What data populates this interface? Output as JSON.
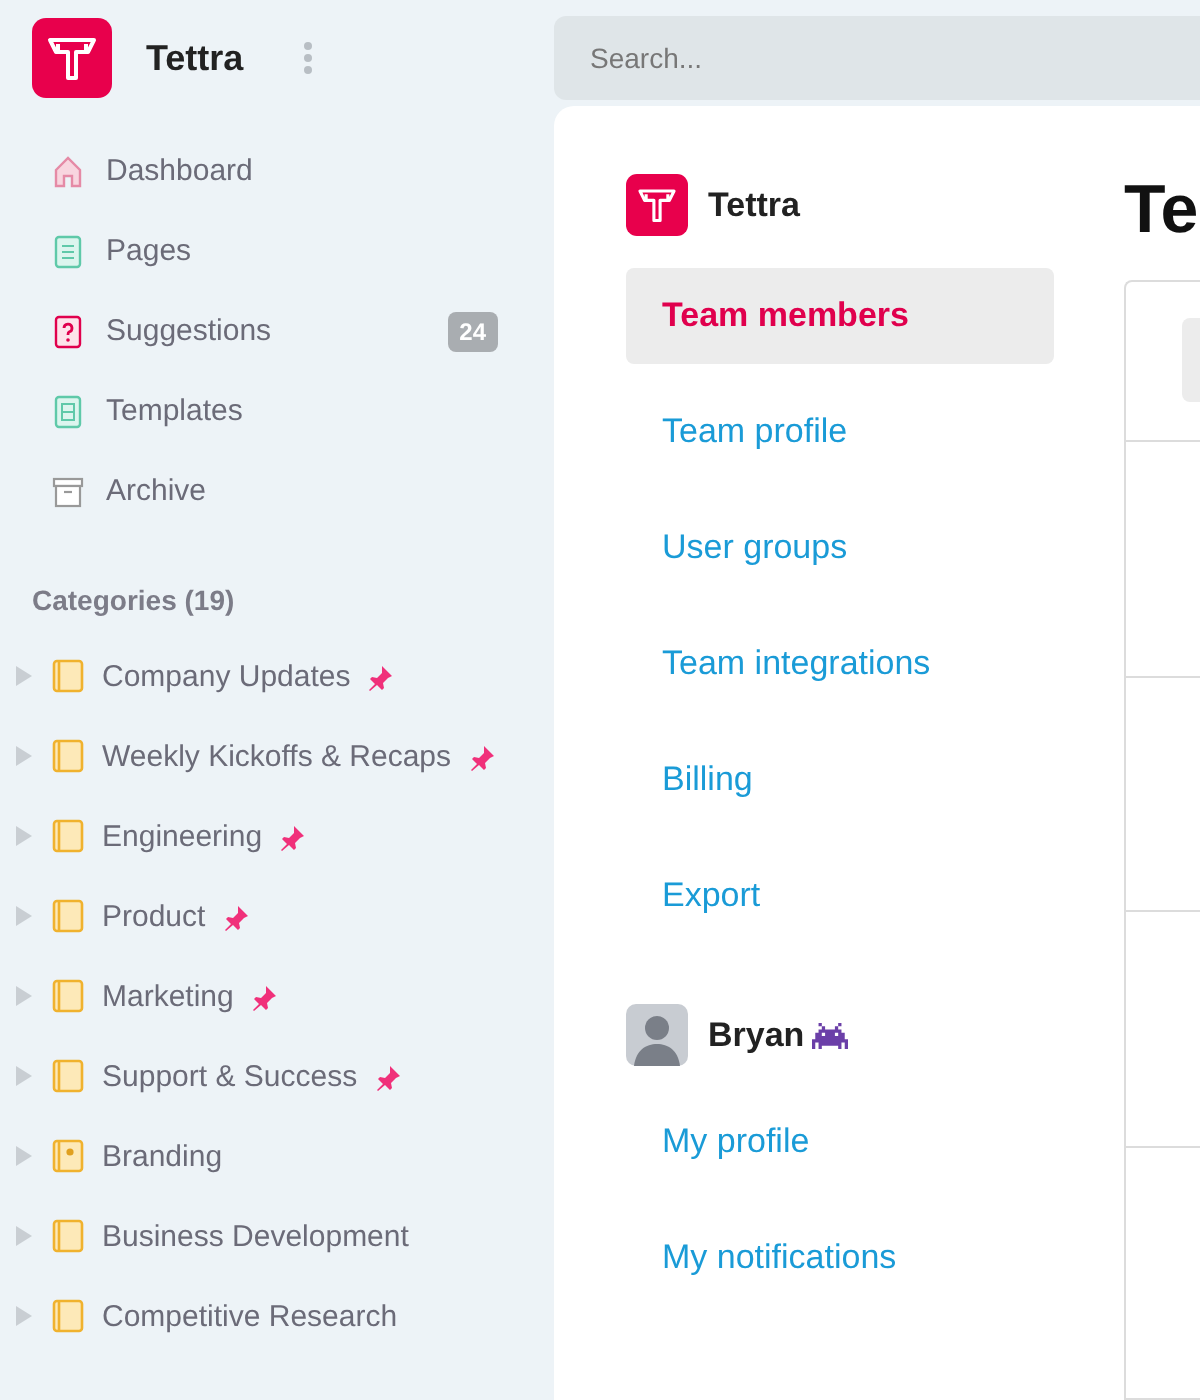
{
  "sidebar": {
    "brand": "Tettra",
    "nav": [
      {
        "label": "Dashboard",
        "kind": "home",
        "selected": false
      },
      {
        "label": "Pages",
        "kind": "page",
        "selected": false
      },
      {
        "label": "Suggestions",
        "kind": "question",
        "selected": false,
        "badge": "24"
      },
      {
        "label": "Templates",
        "kind": "template",
        "selected": false
      },
      {
        "label": "Archive",
        "kind": "archive",
        "selected": false
      }
    ],
    "categories_title": "Categories (19)",
    "categories": [
      {
        "label": "Company Updates",
        "kind": "book",
        "pinned": true
      },
      {
        "label": "Weekly Kickoffs & Recaps",
        "kind": "book",
        "pinned": true
      },
      {
        "label": "Engineering",
        "kind": "book",
        "pinned": true
      },
      {
        "label": "Product",
        "kind": "book",
        "pinned": true
      },
      {
        "label": "Marketing",
        "kind": "book",
        "pinned": true
      },
      {
        "label": "Support & Success",
        "kind": "book",
        "pinned": true
      },
      {
        "label": "Branding",
        "kind": "book-logo",
        "pinned": false
      },
      {
        "label": "Business Development",
        "kind": "book",
        "pinned": false
      },
      {
        "label": "Competitive Research",
        "kind": "book",
        "pinned": false
      }
    ]
  },
  "search": {
    "placeholder": "Search..."
  },
  "settings": {
    "brand": "Tettra",
    "team_items": [
      {
        "label": "Team members",
        "selected": true
      },
      {
        "label": "Team profile",
        "selected": false
      },
      {
        "label": "User groups",
        "selected": false
      },
      {
        "label": "Team integrations",
        "selected": false
      },
      {
        "label": "Billing",
        "selected": false
      },
      {
        "label": "Export",
        "selected": false
      }
    ],
    "user": "Bryan",
    "user_items": [
      {
        "label": "My profile",
        "selected": false
      },
      {
        "label": "My notifications",
        "selected": false
      }
    ]
  },
  "content": {
    "heading": "Te"
  }
}
